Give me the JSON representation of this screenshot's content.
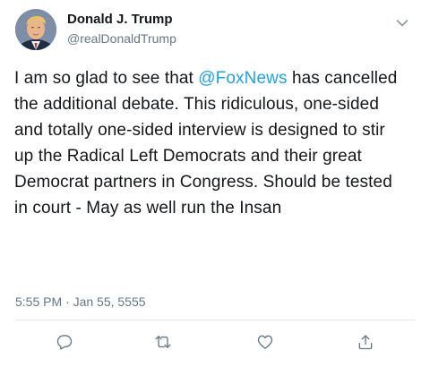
{
  "user": {
    "display_name": "Donald J. Trump",
    "handle": "@realDonaldTrump",
    "avatar_icon": "profile-avatar"
  },
  "tweet": {
    "text_before": "I am so glad to see that ",
    "mention": "@FoxNews",
    "text_after": " has cancelled the additional debate. This ridiculous, one-sided and totally one-sided interview is designed to stir up the Radical Left Democrats and their great Democrat partners in Congress. Should be tested in court - May as well run the Insan",
    "timestamp": "5:55 PM · Jan 55, 5555"
  },
  "icons": {
    "menu": "chevron-down-icon",
    "reply": "reply-icon",
    "retweet": "retweet-icon",
    "like": "like-icon",
    "share": "share-icon"
  },
  "colors": {
    "text": "#14171a",
    "secondary": "#657786",
    "link": "#1da1f2",
    "divider": "#e1e8ed"
  }
}
